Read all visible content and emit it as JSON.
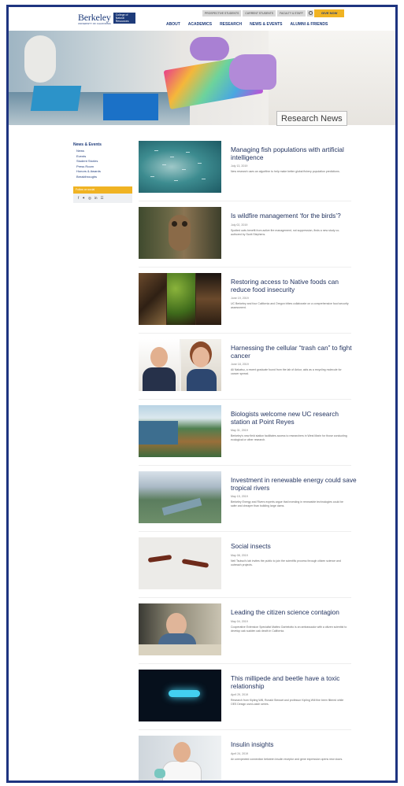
{
  "header": {
    "logo_word": "Berkeley",
    "logo_sub": "UNIVERSITY OF CALIFORNIA",
    "logo_box": "College of Natural Resources",
    "util_links": [
      "PROSPECTIVE STUDENTS",
      "CURRENT STUDENTS",
      "FACULTY & STAFF"
    ],
    "give_label": "GIVE NOW",
    "nav": [
      "ABOUT",
      "ACADEMICS",
      "RESEARCH",
      "NEWS & EVENTS",
      "ALUMNI & FRIENDS"
    ]
  },
  "hero": {
    "title": "Research News"
  },
  "sidebar": {
    "title": "News & Events",
    "items": [
      "News",
      "Events",
      "Student Stories",
      "Press Room",
      "Honors & Awards",
      "Breakthroughs"
    ],
    "social_label": "Follow on social",
    "social_icons": [
      "facebook-icon",
      "twitter-icon",
      "instagram-icon",
      "linkedin-icon",
      "rss-icon"
    ]
  },
  "articles": [
    {
      "title": "Managing fish populations with artificial intelligence",
      "date": "July 13, 2019",
      "desc": "New research uses an algorithm to help make better global fishery population predictions."
    },
    {
      "title": "Is wildfire management ‘for the birds’?",
      "date": "July 02, 2019",
      "desc": "Spotted owls benefit from active fire management, not suppression, finds a new study co-authored by Scott Stephens."
    },
    {
      "title": "Restoring access to Native foods can reduce food insecurity",
      "date": "June 19, 2019",
      "desc": "UC Berkeley and four California and Oregon tribes collaborate on a comprehensive food security assessment."
    },
    {
      "title": "Harnessing the cellular “trash can” to fight cancer",
      "date": "June 18, 2019",
      "desc": "Ali Nakatsu, a recent graduate found from the lab of Ankur, aids as a recycling molecule for cancer spread."
    },
    {
      "title": "Biologists welcome new UC research station at Point Reyes",
      "date": "May 31, 2019",
      "desc": "Berkeley's new field station facilitates access to researchers in West Marin for those conducting ecological or other research."
    },
    {
      "title": "Investment in renewable energy could save tropical rivers",
      "date": "May 15, 2019",
      "desc": "Berkeley Energy and Rivers experts argue that investing in renewable technologies could be safer and cheaper than building large dams."
    },
    {
      "title": "Social insects",
      "date": "May 08, 2019",
      "desc": "Neil Tsutsui's lab invites the public to join the scientific process through citizen science and outreach projects."
    },
    {
      "title": "Leading the citizen science contagion",
      "date": "May 04, 2019",
      "desc": "Cooperative Extension Specialist Matteo Garbelotto is an ambassador with a citizen scientist to develop oak sudden oak death in California."
    },
    {
      "title": "This millipede and beetle have a toxic relationship",
      "date": "April 29, 2019",
      "desc": "Research from Kipling Will, Ronald Stewart and professor Kipling Will fine been filtered while OES Design used-catch series."
    },
    {
      "title": "Insulin insights",
      "date": "April 24, 2019",
      "desc": "An unexpected connection between insulin receptor and gene expression opens new doors."
    }
  ]
}
